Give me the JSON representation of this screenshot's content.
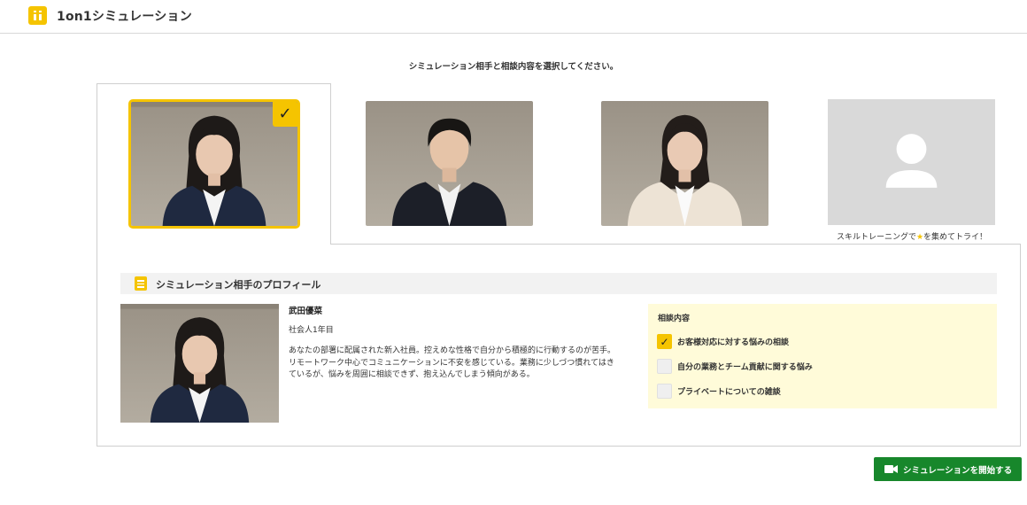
{
  "header": {
    "app_title": "1on1シミュレーション",
    "logo_icon": "app-logo-icon"
  },
  "instruction": "シミュレーション相手と相談内容を選択してください。",
  "personas": [
    {
      "selected": true
    },
    {
      "selected": false
    },
    {
      "selected": false
    },
    {
      "locked": true,
      "caption_before": "スキルトレーニングで",
      "caption_star": "★",
      "caption_after": "を集めてトライ！"
    }
  ],
  "profile": {
    "section_title": "シミュレーション相手のプロフィール",
    "name": "武田優菜",
    "role": "社会人1年目",
    "description": "あなたの部署に配属された新入社員。控えめな性格で自分から積極的に行動するのが苦手。\nリモートワーク中心でコミュニケーションに不安を感じている。業務に少しづつ慣れてはき\nているが、悩みを周囲に相談できず、抱え込んでしまう傾向がある。"
  },
  "topics": {
    "title": "相談内容",
    "check_mark": "✓",
    "items": [
      {
        "label": "お客様対応に対する悩みの相談",
        "checked": true
      },
      {
        "label": "自分の業務とチーム貢献に関する悩み",
        "checked": false
      },
      {
        "label": "プライベートについての雑談",
        "checked": false
      }
    ]
  },
  "start_button": {
    "label": "シミュレーションを開始する",
    "icon": "video-camera-icon"
  },
  "colors": {
    "accent": "#f5c400",
    "primary_button": "#17872b",
    "topics_background": "#fffbd9"
  }
}
